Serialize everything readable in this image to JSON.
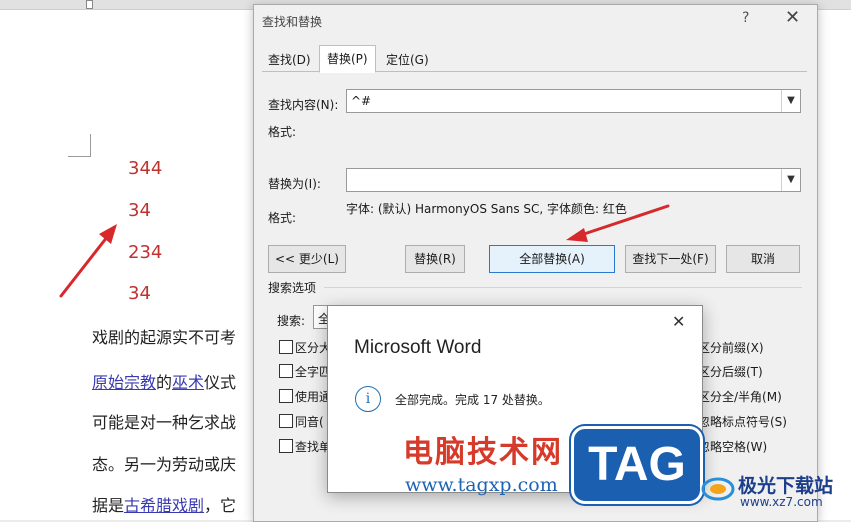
{
  "document": {
    "numbers": [
      "344",
      "34",
      "234",
      "34"
    ],
    "paragraphs": [
      {
        "segments": [
          {
            "text": "戏剧的起源实不可考"
          }
        ]
      },
      {
        "segments": [
          {
            "text": "原始宗教",
            "link": true
          },
          {
            "text": "的"
          },
          {
            "text": "巫术",
            "link": true
          },
          {
            "text": "仪式"
          }
        ]
      },
      {
        "segments": [
          {
            "text": "可能是对一种乞求战"
          }
        ]
      },
      {
        "segments": [
          {
            "text": "态。另一为劳动或庆"
          }
        ]
      },
      {
        "segments": [
          {
            "text": "据是"
          },
          {
            "text": "古希腊戏剧",
            "link": true
          },
          {
            "text": "，它"
          }
        ]
      }
    ]
  },
  "dialog": {
    "title": "查找和替换",
    "help": "?",
    "close": "✕",
    "tabs": [
      {
        "label": "查找(D)",
        "active": false
      },
      {
        "label": "替换(P)",
        "active": true
      },
      {
        "label": "定位(G)",
        "active": false
      }
    ],
    "find_label": "查找内容(N):",
    "find_value": "^#",
    "format_label": "格式:",
    "replace_label": "替换为(I):",
    "replace_value": "",
    "replace_format_label": "格式:",
    "replace_format_value": "字体: (默认) HarmonyOS Sans SC, 字体颜色: 红色",
    "buttons": {
      "less": "<< 更少(L)",
      "replace": "替换(R)",
      "replace_all": "全部替换(A)",
      "find_next": "查找下一处(F)",
      "cancel": "取消"
    },
    "search_options_label": "搜索选项",
    "search_label": "搜索:",
    "search_value": "全",
    "left_options": [
      "区分大",
      "全字匹",
      "使用通",
      "同音(",
      "查找单"
    ],
    "right_options": [
      "区分前缀(X)",
      "区分后缀(T)",
      "区分全/半角(M)",
      "忽略标点符号(S)",
      "忽略空格(W)"
    ]
  },
  "message_box": {
    "title": "Microsoft Word",
    "close": "✕",
    "icon": "info-icon",
    "text": "全部完成。完成 17 处替换。"
  },
  "watermark": {
    "cn": "电脑技术网",
    "url": "www.tagxp.com",
    "tag": "TAG",
    "site2": "极光下载站",
    "site2_url": "www.xz7.com"
  },
  "colors": {
    "number_red": "#c0312f",
    "arrow_red": "#d7282c",
    "link_blue": "#3a3ab0",
    "focus_blue": "#2b78d0",
    "tag_blue": "#1b5fb0"
  }
}
